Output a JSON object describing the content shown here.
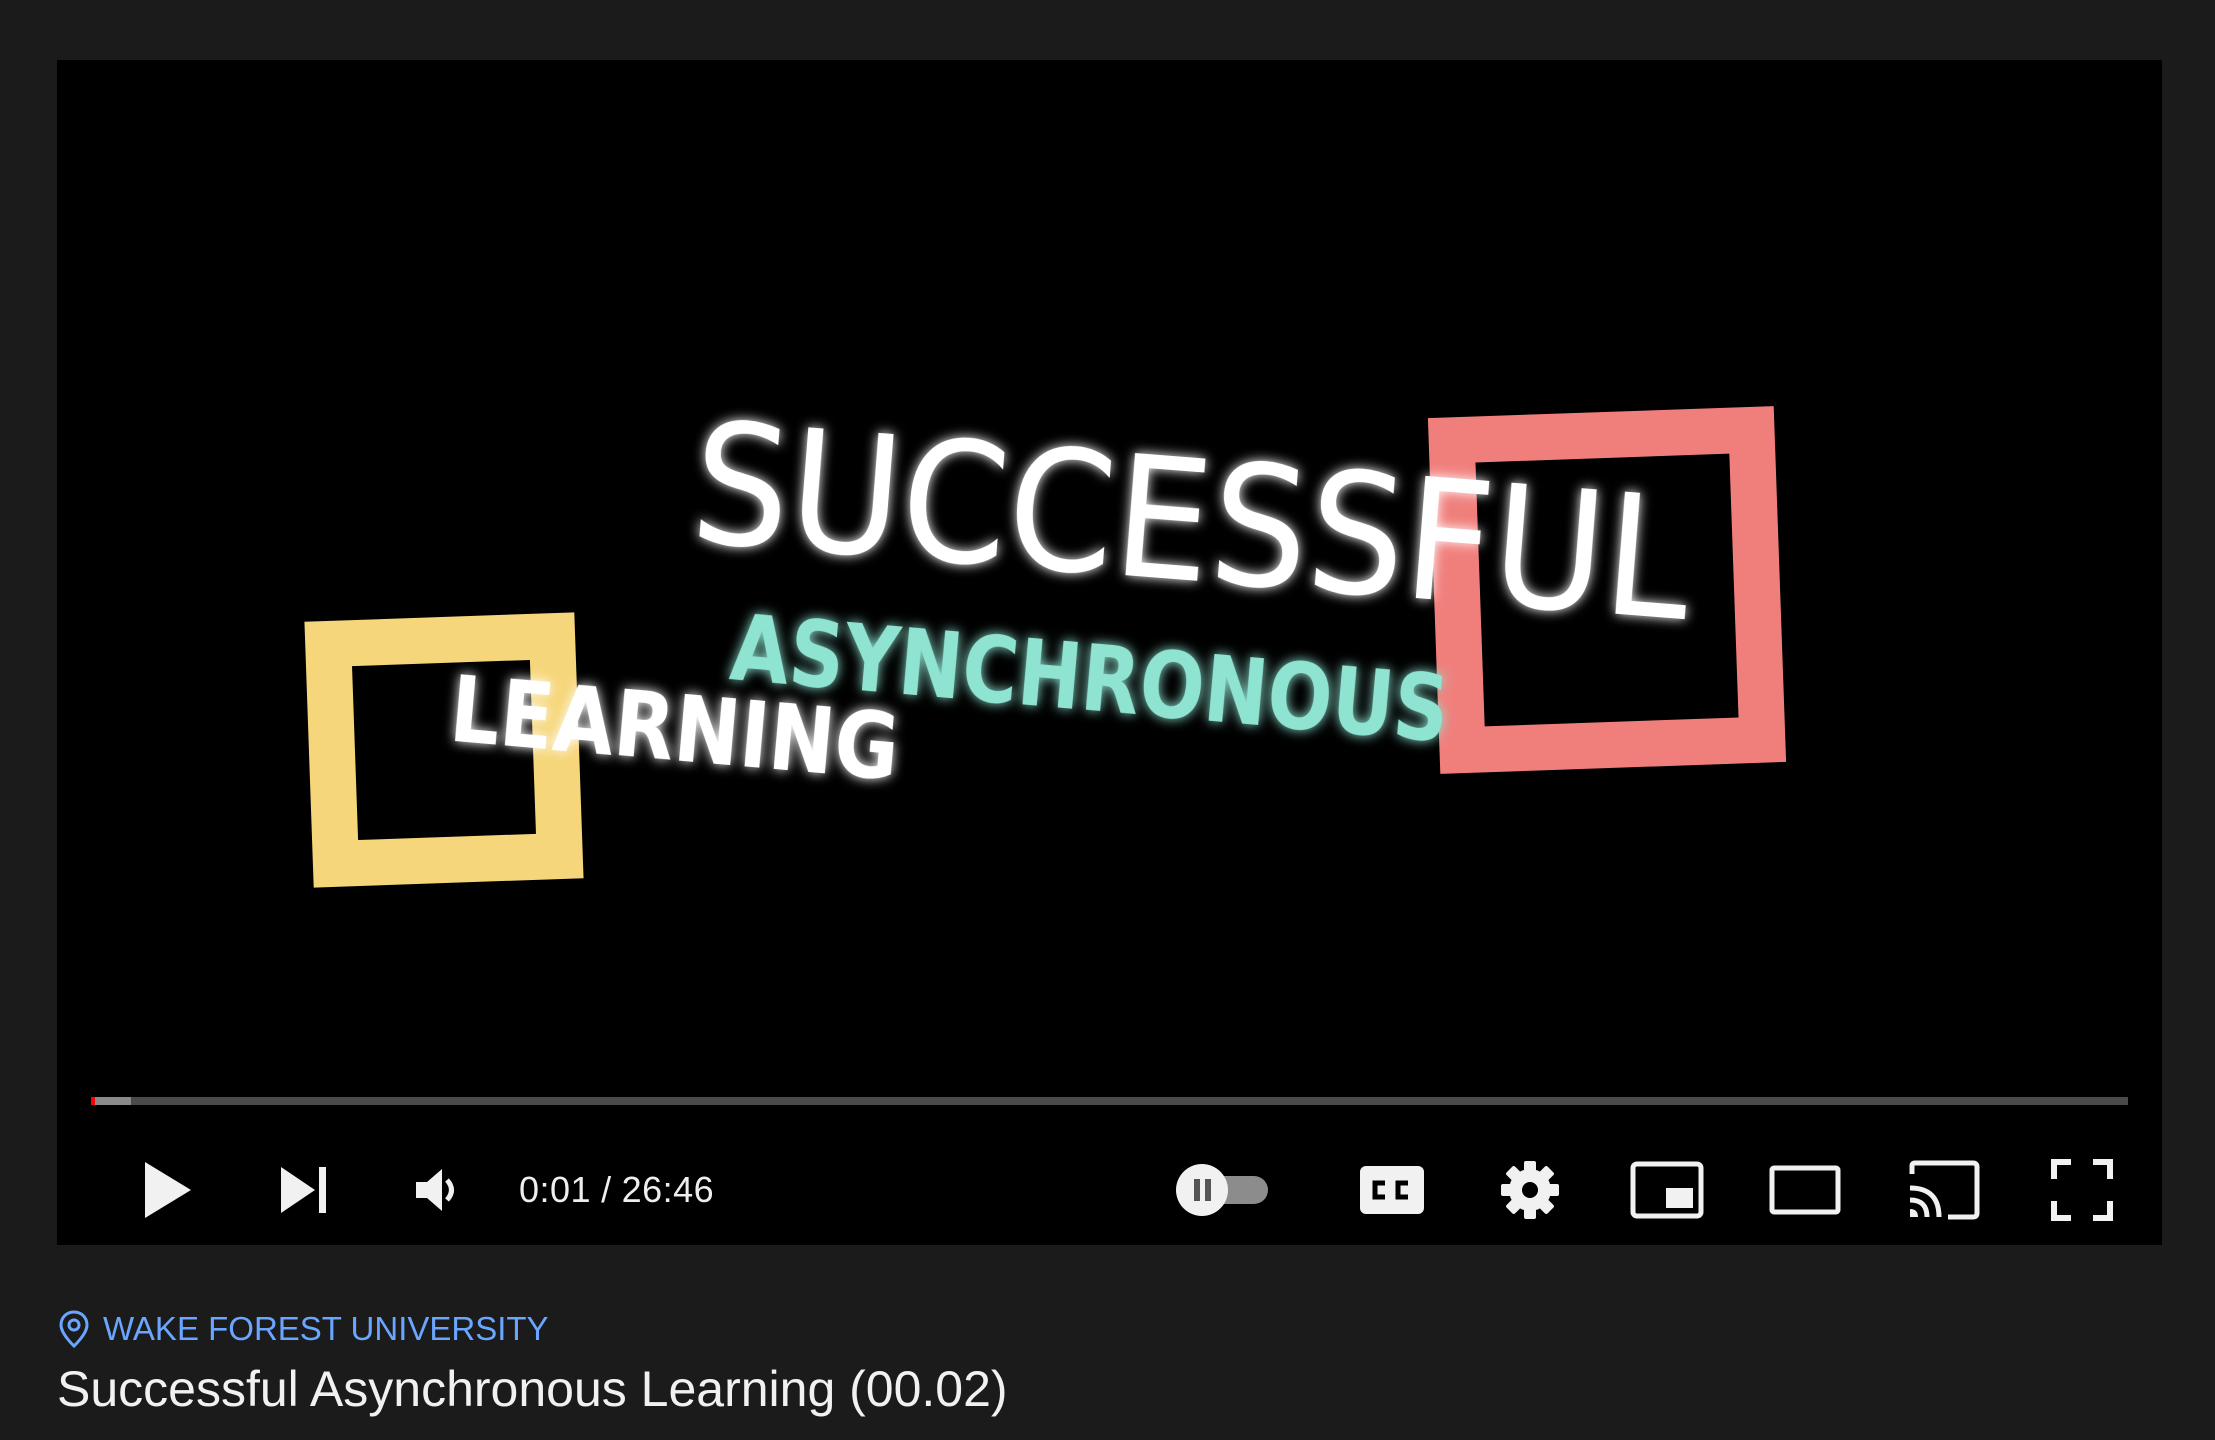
{
  "video": {
    "title_card": {
      "line1": "SUCCESSFUL",
      "line2": "ASYNCHRONOUS",
      "line3": "LEARNING"
    },
    "progress_fraction": 0.0006,
    "current_time": "0:01",
    "separator": "/",
    "duration": "26:46"
  },
  "controls": {
    "play_icon": "play-icon",
    "next_icon": "next-icon",
    "volume_icon": "volume-icon",
    "autoplay_icon": "autoplay-toggle-icon",
    "captions_icon": "captions-icon",
    "settings_icon": "gear-icon",
    "miniplayer_icon": "miniplayer-icon",
    "theater_icon": "theater-icon",
    "cast_icon": "cast-icon",
    "fullscreen_icon": "fullscreen-icon"
  },
  "info": {
    "location": "WAKE FOREST UNIVERSITY",
    "title": "Successful Asynchronous Learning (00.02)"
  },
  "colors": {
    "background": "#1b1b1b",
    "player": "#000000",
    "accent_red": "#ff0000",
    "link_blue": "#6aa6ff",
    "title_yellow": "#f6d67a",
    "title_teal": "#8fe3d1",
    "title_coral": "#f07f7c"
  }
}
